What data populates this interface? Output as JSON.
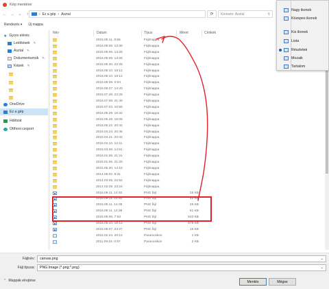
{
  "window": {
    "title": "Kép mentése"
  },
  "nav": {
    "breadcrumb": [
      "Ez a gép",
      "Asztal"
    ],
    "search_placeholder": "Keresés: Asztal"
  },
  "toolbar": {
    "organize_label": "Rendezés ▾",
    "new_folder_label": "Új mappa"
  },
  "view_menu": {
    "items": [
      {
        "label": "Nagy ikonok",
        "selected": false
      },
      {
        "label": "Közepes ikonok",
        "selected": false
      },
      {
        "label": "Kis ikonok",
        "selected": false
      },
      {
        "label": "Lista",
        "selected": false
      },
      {
        "label": "Részletek",
        "selected": true
      },
      {
        "label": "Mozaik",
        "selected": false
      },
      {
        "label": "Tartalom",
        "selected": false
      }
    ]
  },
  "sidebar": {
    "items": [
      {
        "label": "Gyors elérés",
        "icon": "star-icon"
      },
      {
        "label": "Letöltések",
        "icon": "download-icon",
        "pinned": true
      },
      {
        "label": "Asztal",
        "icon": "desktop-icon",
        "pinned": true
      },
      {
        "label": "Dokumentumok",
        "icon": "documents-icon",
        "pinned": true
      },
      {
        "label": "Képek",
        "icon": "pictures-icon",
        "pinned": true
      },
      {
        "label": "",
        "icon": "folder-icon"
      },
      {
        "label": "",
        "icon": "folder-icon"
      },
      {
        "label": "",
        "icon": "folder-icon"
      },
      {
        "label": "",
        "icon": "folder-icon"
      },
      {
        "label": "OneDrive",
        "icon": "cloud-icon"
      },
      {
        "label": "Ez a gép",
        "icon": "computer-icon",
        "selected": true
      },
      {
        "label": "Hálózat",
        "icon": "network-icon"
      },
      {
        "label": "Otthoni csoport",
        "icon": "homegroup-icon"
      }
    ]
  },
  "columns": {
    "name": "Név",
    "date": "Dátum",
    "type": "Típus",
    "size": "Méret",
    "tags": "Címkék"
  },
  "files": [
    {
      "date": "2016.09.11. 9:56",
      "type": "Fájlmappa",
      "size": "",
      "kind": "folder"
    },
    {
      "date": "2016.09.06. 13:30",
      "type": "Fájlmappa",
      "size": "",
      "kind": "folder"
    },
    {
      "date": "2016.09.06. 13:26",
      "type": "Fájlmappa",
      "size": "",
      "kind": "folder"
    },
    {
      "date": "2016.09.06. 13:26",
      "type": "Fájlmappa",
      "size": "",
      "kind": "folder"
    },
    {
      "date": "2016.08.30. 22:28",
      "type": "Fájlmappa",
      "size": "",
      "kind": "folder"
    },
    {
      "date": "2016.08.10. 18:12",
      "type": "Fájlmappa",
      "size": "",
      "kind": "folder"
    },
    {
      "date": "2016.08.10. 18:12",
      "type": "Fájlmappa",
      "size": "",
      "kind": "folder"
    },
    {
      "date": "2016.08.08. 0:04",
      "type": "Fájlmappa",
      "size": "",
      "kind": "folder"
    },
    {
      "date": "2016.08.07. 14:43",
      "type": "Fájlmappa",
      "size": "",
      "kind": "folder"
    },
    {
      "date": "2016.07.28. 22:29",
      "type": "Fájlmappa",
      "size": "",
      "kind": "folder"
    },
    {
      "date": "2016.07.08. 21:40",
      "type": "Fájlmappa",
      "size": "",
      "kind": "folder"
    },
    {
      "date": "2016.07.03. 10:55",
      "type": "Fájlmappa",
      "size": "",
      "kind": "folder"
    },
    {
      "date": "2016.05.29. 15:32",
      "type": "Fájlmappa",
      "size": "",
      "kind": "folder"
    },
    {
      "date": "2016.05.29. 15:06",
      "type": "Fájlmappa",
      "size": "",
      "kind": "folder"
    },
    {
      "date": "2016.05.22. 20:42",
      "type": "Fájlmappa",
      "size": "",
      "kind": "folder"
    },
    {
      "date": "2016.04.24. 20:46",
      "type": "Fájlmappa",
      "size": "",
      "kind": "folder"
    },
    {
      "date": "2016.04.21. 20:44",
      "type": "Fájlmappa",
      "size": "",
      "kind": "folder"
    },
    {
      "date": "2016.04.10. 12:11",
      "type": "Fájlmappa",
      "size": "",
      "kind": "folder"
    },
    {
      "date": "2016.03.06. 14:51",
      "type": "Fájlmappa",
      "size": "",
      "kind": "folder"
    },
    {
      "date": "2016.01.06. 21:21",
      "type": "Fájlmappa",
      "size": "",
      "kind": "folder"
    },
    {
      "date": "2016.01.06. 21:20",
      "type": "Fájlmappa",
      "size": "",
      "kind": "folder"
    },
    {
      "date": "2015.05.30. 14:10",
      "type": "Fájlmappa",
      "size": "",
      "kind": "folder"
    },
    {
      "date": "2014.09.02. 9:31",
      "type": "Fájlmappa",
      "size": "",
      "kind": "folder"
    },
    {
      "date": "2014.03.05. 22:52",
      "type": "Fájlmappa",
      "size": "",
      "kind": "folder"
    },
    {
      "date": "2014.02.09. 23:24",
      "type": "Fájlmappa",
      "size": "",
      "kind": "folder"
    },
    {
      "date": "2016.09.11. 14:40",
      "type": "PNG fájl",
      "size": "25 KB",
      "kind": "image"
    },
    {
      "date": "2016.09.11. 14:40",
      "type": "PNG fájl",
      "size": "42 KB",
      "kind": "image"
    },
    {
      "date": "2016.09.11. 14:39",
      "type": "PNG fájl",
      "size": "26 KB",
      "kind": "image"
    },
    {
      "date": "2016.09.11. 14:38",
      "type": "PNG fájl",
      "size": "51 KB",
      "kind": "image"
    },
    {
      "date": "2016.09.06. 7:53",
      "type": "PNG fájl",
      "size": "533 KB",
      "kind": "image"
    },
    {
      "date": "2016.08.10. 18:12",
      "type": "PNG fájl",
      "size": "578 KB",
      "kind": "image"
    },
    {
      "date": "2016.08.07. 23:27",
      "type": "PNG fájl",
      "size": "16 KB",
      "kind": "image"
    },
    {
      "date": "2015.02.24. 20:12",
      "type": "Parancsikon",
      "size": "1 KB",
      "kind": "shortcut"
    },
    {
      "date": "2011.09.15. 0:57",
      "type": "Parancsikon",
      "size": "2 KB",
      "kind": "shortcut"
    }
  ],
  "form": {
    "filename_label": "Fájlnév:",
    "filename_value": "canvas.png",
    "filetype_label": "Fájl típusa:",
    "filetype_value": "PNG Image (*.png;*.png)"
  },
  "footer": {
    "hide_folders_label": "Mappák elrejtése",
    "save_label": "Mentés",
    "cancel_label": "Mégse"
  },
  "colors": {
    "accent": "#1a5fb4",
    "highlight_box": "#e0202a",
    "annotation": "#e0202a",
    "selection": "#cce4f7"
  }
}
